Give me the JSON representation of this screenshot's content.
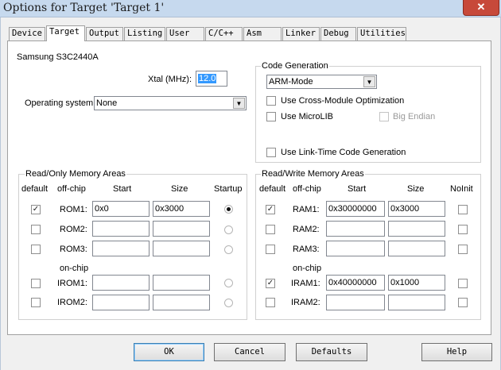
{
  "window": {
    "title": "Options for Target 'Target 1'",
    "close_glyph": "✕"
  },
  "tabs": [
    "Device",
    "Target",
    "Output",
    "Listing",
    "User",
    "C/C++",
    "Asm",
    "Linker",
    "Debug",
    "Utilities"
  ],
  "device_name": "Samsung S3C2440A",
  "xtal": {
    "label": "Xtal (MHz):",
    "value": "12.0"
  },
  "os": {
    "label": "Operating system:",
    "value": "None"
  },
  "code_gen": {
    "title": "Code Generation",
    "mode": "ARM-Mode",
    "cross_module": "Use Cross-Module Optimization",
    "microlib": "Use MicroLIB",
    "big_endian": "Big Endian",
    "link_time": "Use Link-Time Code Generation"
  },
  "rom_areas": {
    "title": "Read/Only Memory Areas",
    "headers": {
      "default": "default",
      "offchip": "off-chip",
      "start": "Start",
      "size": "Size",
      "startup": "Startup"
    },
    "onchip_label": "on-chip",
    "rows": [
      {
        "name": "ROM1:",
        "start": "0x0",
        "size": "0x3000",
        "default": true,
        "startup": true
      },
      {
        "name": "ROM2:",
        "start": "",
        "size": "",
        "default": false,
        "startup": false
      },
      {
        "name": "ROM3:",
        "start": "",
        "size": "",
        "default": false,
        "startup": false
      },
      {
        "name": "IROM1:",
        "start": "",
        "size": "",
        "default": false,
        "startup": false
      },
      {
        "name": "IROM2:",
        "start": "",
        "size": "",
        "default": false,
        "startup": false
      }
    ]
  },
  "ram_areas": {
    "title": "Read/Write Memory Areas",
    "headers": {
      "default": "default",
      "offchip": "off-chip",
      "start": "Start",
      "size": "Size",
      "noinit": "NoInit"
    },
    "onchip_label": "on-chip",
    "rows": [
      {
        "name": "RAM1:",
        "start": "0x30000000",
        "size": "0x3000",
        "default": true,
        "noinit": false
      },
      {
        "name": "RAM2:",
        "start": "",
        "size": "",
        "default": false,
        "noinit": false
      },
      {
        "name": "RAM3:",
        "start": "",
        "size": "",
        "default": false,
        "noinit": false
      },
      {
        "name": "IRAM1:",
        "start": "0x40000000",
        "size": "0x1000",
        "default": true,
        "noinit": false
      },
      {
        "name": "IRAM2:",
        "start": "",
        "size": "",
        "default": false,
        "noinit": false
      }
    ]
  },
  "buttons": {
    "ok": "OK",
    "cancel": "Cancel",
    "defaults": "Defaults",
    "help": "Help"
  },
  "glyphs": {
    "check": "✓",
    "dropdown": "▼"
  }
}
